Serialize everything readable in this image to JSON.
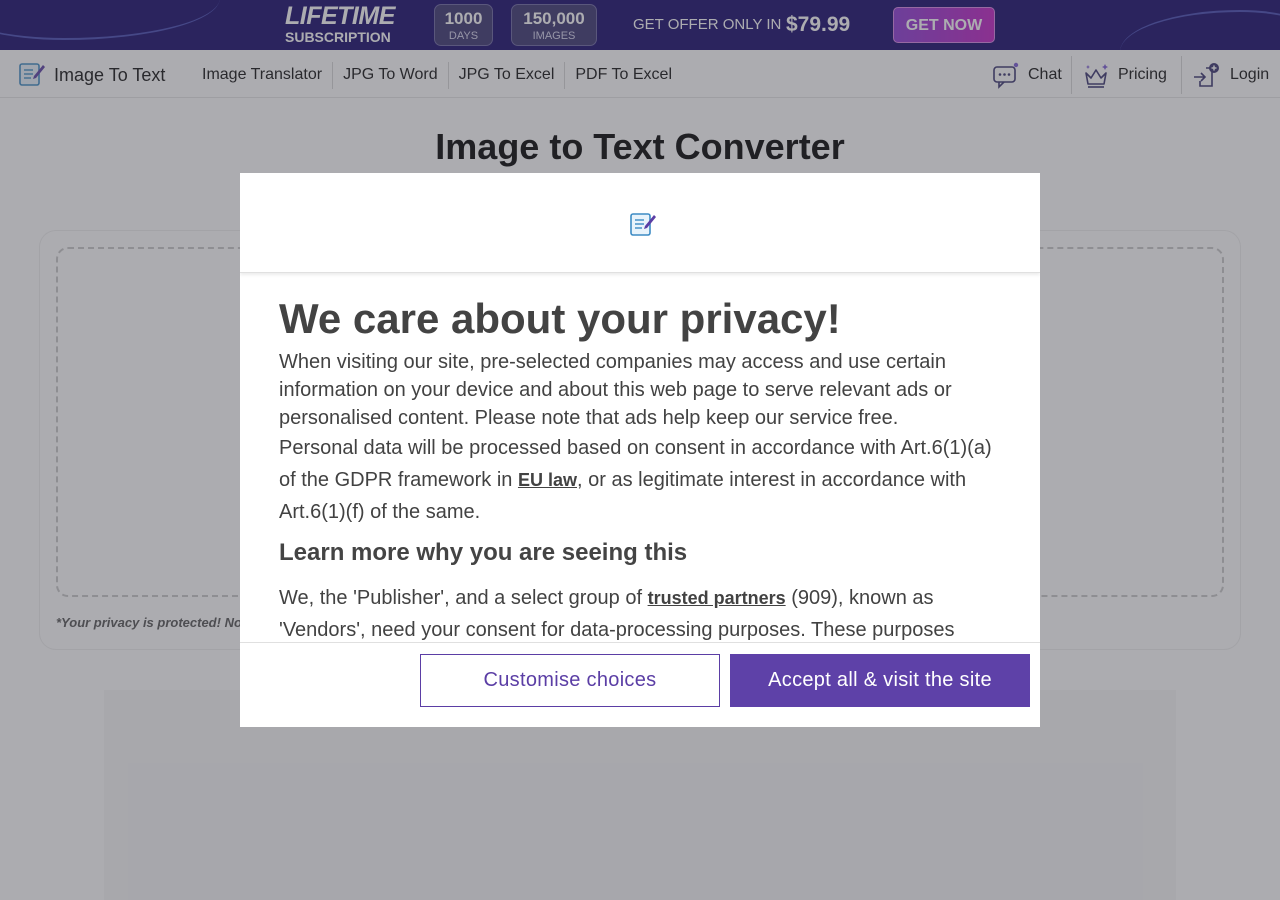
{
  "promo": {
    "lifetime": "LIFETIME",
    "subscription": "SUBSCRIPTION",
    "days_value": "1000",
    "days_label": "DAYS",
    "images_value": "150,000",
    "images_label": "IMAGES",
    "offer_text": "GET OFFER ONLY IN",
    "price": "$79.99",
    "cta": "GET NOW"
  },
  "nav": {
    "logo_text": "Image To Text",
    "links": [
      "Image Translator",
      "JPG To Word",
      "JPG To Excel",
      "PDF To Excel"
    ],
    "chat": "Chat",
    "pricing": "Pricing",
    "login": "Login"
  },
  "page": {
    "title": "Image to Text Converter",
    "privacy_note": "*Your privacy is protected! No"
  },
  "consent": {
    "heading": "We care about your privacy!",
    "intro": "When visiting our site, pre-selected companies may access and use certain information on your device and about this web page to serve relevant ads or personalised content. Please note that ads help keep our service free.",
    "gdpr_before": "Personal data will be processed based on consent in accordance with Art.6(1)(a) of the GDPR framework in ",
    "gdpr_link": "EU law",
    "gdpr_after": ", or as legitimate interest in accordance with Art.6(1)(f) of the same.",
    "learn_more": "Learn more why you are seeing this",
    "vendors_before": "We, the 'Publisher', and a select group of ",
    "vendors_link": "trusted partners",
    "vendors_after": " (909), known as 'Vendors', need your consent for data-processing purposes. These purposes",
    "customise_button": "Customise choices",
    "accept_button": "Accept all & visit the site"
  },
  "colors": {
    "promo_bg": "#14096b",
    "accent": "#5e41a8",
    "overlay": "rgba(70,70,80,0.45)"
  }
}
